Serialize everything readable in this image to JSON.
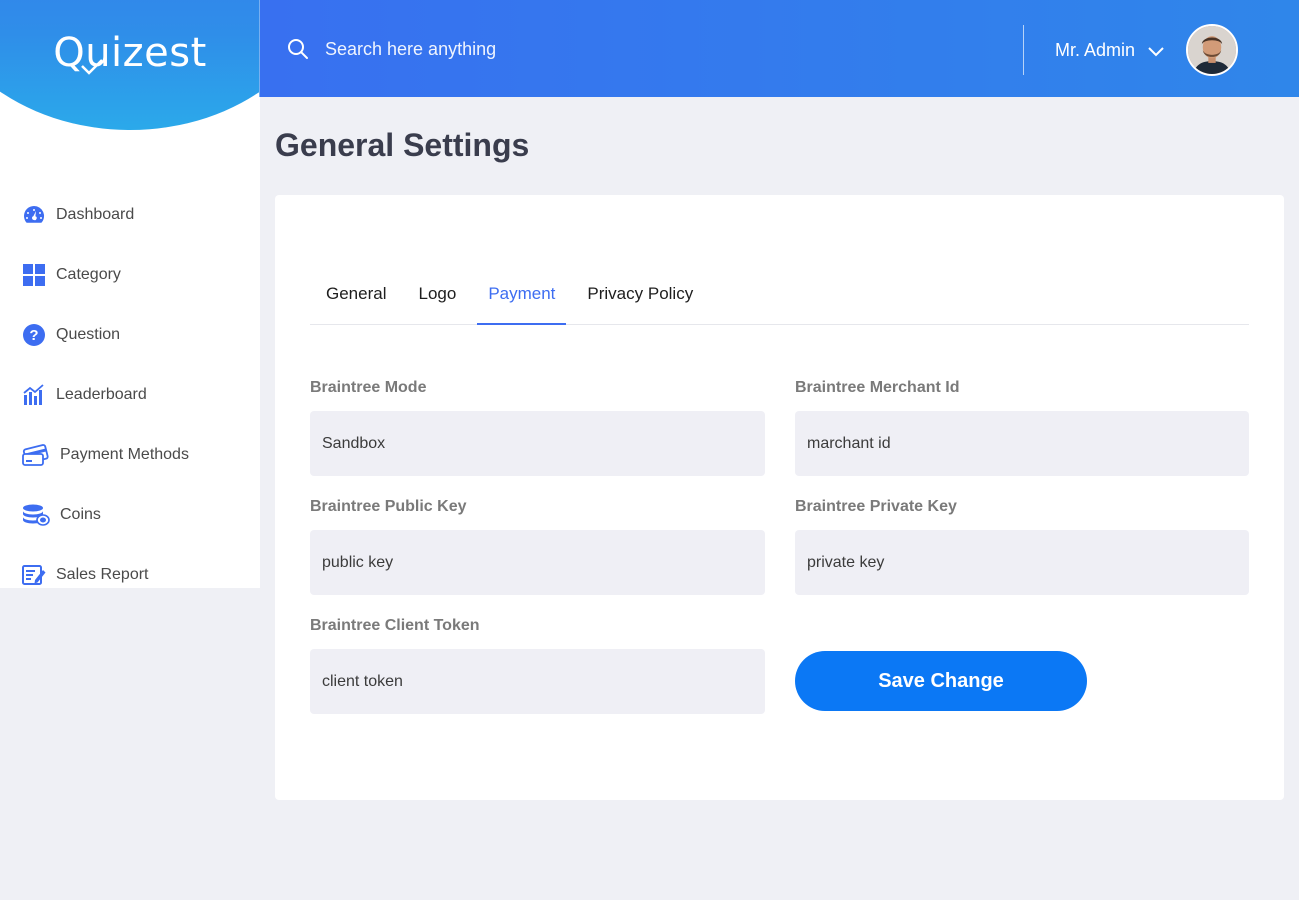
{
  "app": {
    "name": "Quizest"
  },
  "sidebar": {
    "items": [
      {
        "label": "Dashboard",
        "icon": "dashboard-icon"
      },
      {
        "label": "Category",
        "icon": "grid-icon"
      },
      {
        "label": "Question",
        "icon": "question-icon"
      },
      {
        "label": "Leaderboard",
        "icon": "bar-chart-icon"
      },
      {
        "label": "Payment Methods",
        "icon": "credit-card-icon"
      },
      {
        "label": "Coins",
        "icon": "coins-icon"
      },
      {
        "label": "Sales Report",
        "icon": "report-icon"
      }
    ]
  },
  "header": {
    "search_placeholder": "Search here anything",
    "user_name": "Mr. Admin"
  },
  "main": {
    "title": "General Settings",
    "tabs": [
      {
        "label": "General",
        "active": false
      },
      {
        "label": "Logo",
        "active": false
      },
      {
        "label": "Payment",
        "active": true
      },
      {
        "label": "Privacy Policy",
        "active": false
      }
    ],
    "fields": {
      "mode": {
        "label": "Braintree Mode",
        "value": "Sandbox"
      },
      "merchant_id": {
        "label": "Braintree Merchant Id",
        "value": "marchant id"
      },
      "public_key": {
        "label": "Braintree Public Key",
        "value": "public key"
      },
      "private_key": {
        "label": "Braintree Private Key",
        "value": "private key"
      },
      "client_token": {
        "label": "Braintree Client Token",
        "value": "client token"
      }
    },
    "save_label": "Save Change"
  },
  "colors": {
    "primary": "#3d6df1",
    "button": "#0b78f5",
    "page_background": "#eff0f5",
    "input_background": "#efeff5"
  }
}
